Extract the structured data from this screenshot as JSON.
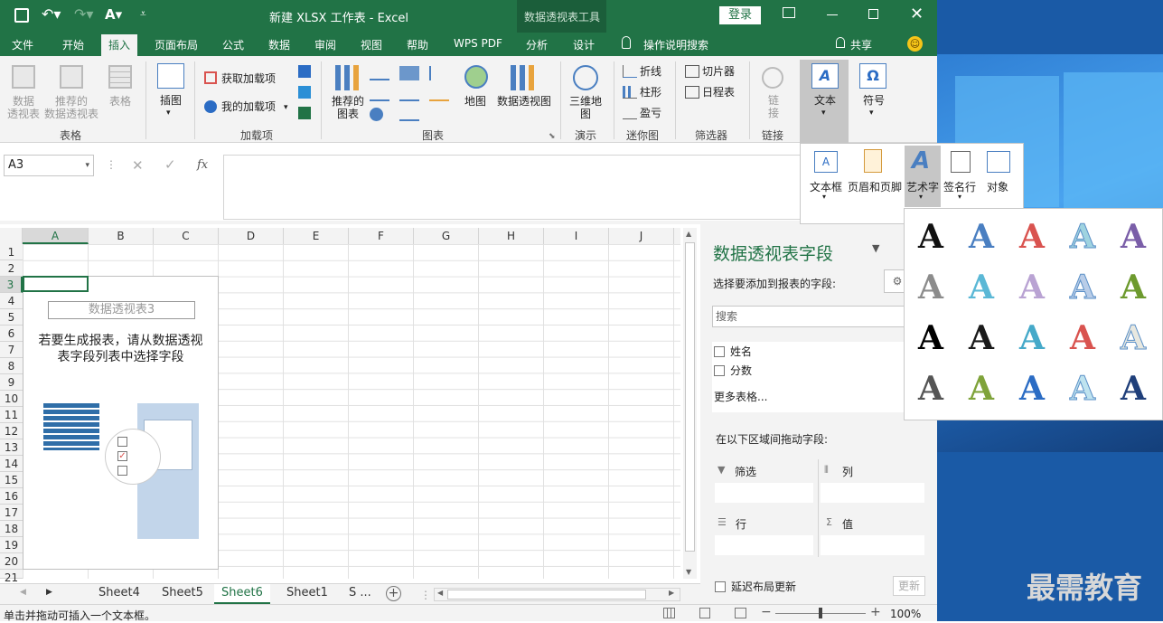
{
  "title": {
    "doc": "新建 XLSX 工作表",
    "sep": "-",
    "app": "Excel",
    "tools": "数据透视表工具",
    "login": "登录"
  },
  "tabs": [
    "文件",
    "开始",
    "插入",
    "页面布局",
    "公式",
    "数据",
    "审阅",
    "视图",
    "帮助",
    "WPS PDF",
    "分析",
    "设计"
  ],
  "tell_me": "操作说明搜索",
  "share": "共享",
  "ribbon": {
    "pivot": "数据\n透视表",
    "rec_pivot": "推荐的\n数据透视表",
    "table": "表格",
    "group_table": "表格",
    "illus": "插图",
    "get_addins": "获取加载项",
    "my_addins": "我的加载项",
    "group_addins": "加载项",
    "rec_charts": "推荐的\n图表",
    "maps": "地图",
    "pivot_chart": "数据透视图",
    "group_charts": "图表",
    "map3d": "三维地\n图",
    "group_tours": "演示",
    "spark_line": "折线",
    "spark_col": "柱形",
    "spark_wl": "盈亏",
    "group_spark": "迷你图",
    "slicer": "切片器",
    "timeline": "日程表",
    "group_filter": "筛选器",
    "link": "链\n接",
    "group_link": "链接",
    "text": "文本",
    "symbol": "符号"
  },
  "text_drop": {
    "textbox": "文本框",
    "header": "页眉和页脚",
    "wordart": "艺术字",
    "sigline": "签名行",
    "object": "对象"
  },
  "formula": {
    "namebox": "A3",
    "fx": "fx"
  },
  "columns": [
    "A",
    "B",
    "C",
    "D",
    "E",
    "F",
    "G",
    "H",
    "I",
    "J"
  ],
  "rows": [
    "1",
    "2",
    "3",
    "4",
    "5",
    "6",
    "7",
    "8",
    "9",
    "10",
    "11",
    "12",
    "13",
    "14",
    "15",
    "16",
    "17",
    "18",
    "19",
    "20",
    "21"
  ],
  "pivot_placeholder": {
    "name": "数据透视表3",
    "hint1": "若要生成报表，请从数据透视",
    "hint2": "表字段列表中选择字段"
  },
  "pane": {
    "title": "数据透视表字段",
    "choose": "选择要添加到报表的字段:",
    "search": "搜索",
    "fields": [
      "姓名",
      "分数"
    ],
    "more": "更多表格...",
    "drag": "在以下区域间拖动字段:",
    "filter": "筛选",
    "cols": "列",
    "rows": "行",
    "values": "值",
    "defer": "延迟布局更新",
    "update": "更新"
  },
  "sheets": [
    "Sheet4",
    "Sheet5",
    "Sheet6",
    "Sheet1",
    "S ..."
  ],
  "status": {
    "msg": "单击并拖动可插入一个文本框。",
    "zoom": "100%"
  },
  "watermark": "最需教育",
  "wordart_colors": [
    "#111111",
    "#4a7fc1",
    "#d9534f",
    "#9fd3e0",
    "#7a5ea8",
    "#8c8c8c",
    "#5bb8d6",
    "#b9a3d3",
    "#b9cde8",
    "#6d9a2e",
    "#000000",
    "#1a1a1a",
    "#45a9c9",
    "#d9534f",
    "#e8e8e0",
    "#555555",
    "#7fa33a",
    "#2b6cc4",
    "#bfe3ef",
    "#1f3f7a"
  ]
}
